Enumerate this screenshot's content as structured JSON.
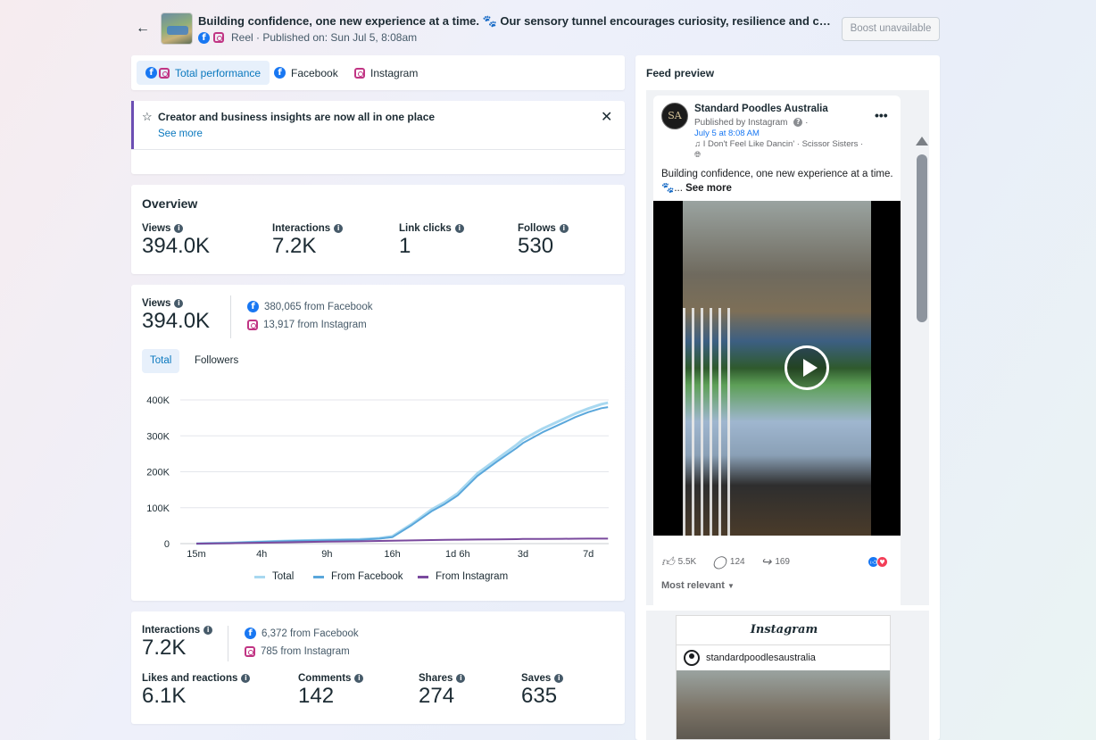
{
  "header": {
    "title": "Building confidence, one new experience at a time. 🐾 Our sensory tunnel encourages curiosity, resilience and confidence. Every step, every sound, every texture, it's all part of raising calm and confident puppies.",
    "meta": "Reel · Published on: Sun Jul 5, 8:08am",
    "boost_label": "Boost unavailable"
  },
  "tabs": [
    {
      "label": "Total performance"
    },
    {
      "label": "Facebook"
    },
    {
      "label": "Instagram"
    }
  ],
  "notice": {
    "title": "Creator and business insights are now all in one place",
    "link": "See more"
  },
  "overview": {
    "title": "Overview",
    "metrics": [
      {
        "label": "Views",
        "value": "394.0K"
      },
      {
        "label": "Interactions",
        "value": "7.2K"
      },
      {
        "label": "Link clicks",
        "value": "1"
      },
      {
        "label": "Follows",
        "value": "530"
      }
    ]
  },
  "views": {
    "label": "Views",
    "value": "394.0K",
    "facebook": "380,065 from Facebook",
    "instagram": "13,917 from Instagram",
    "toggle": [
      "Total",
      "Followers"
    ]
  },
  "chart_data": {
    "type": "line",
    "x_ticks": [
      "15m",
      "4h",
      "9h",
      "16h",
      "1d 6h",
      "3d",
      "7d"
    ],
    "y_ticks": [
      "0",
      "100K",
      "200K",
      "300K",
      "400K"
    ],
    "ylim": [
      0,
      400000
    ],
    "grid": true,
    "legend_position": "bottom",
    "x_index": [
      0,
      0.5,
      1,
      1.5,
      2,
      2.5,
      2.8,
      3,
      3.3,
      3.6,
      3.8,
      4,
      4.3,
      4.6,
      4.9,
      5,
      5.3,
      5.6,
      5.8,
      6,
      6.2,
      6.3
    ],
    "series": [
      {
        "name": "Total",
        "color": "#a8d8f0",
        "values": [
          0,
          2000,
          5000,
          8000,
          10000,
          12000,
          15000,
          20000,
          55000,
          95000,
          115000,
          140000,
          195000,
          235000,
          275000,
          290000,
          320000,
          345000,
          362000,
          376000,
          388000,
          392000
        ]
      },
      {
        "name": "From Facebook",
        "color": "#5aa7db",
        "values": [
          0,
          2000,
          5000,
          7500,
          9500,
          11000,
          14000,
          18000,
          52000,
          90000,
          110000,
          134000,
          188000,
          228000,
          266000,
          280000,
          310000,
          335000,
          352000,
          366000,
          377000,
          380000
        ]
      },
      {
        "name": "From Instagram",
        "color": "#7a4a9e",
        "values": [
          0,
          1000,
          2500,
          4000,
          5500,
          6500,
          7500,
          8000,
          9000,
          10000,
          10500,
          11000,
          11500,
          12000,
          12500,
          13000,
          13200,
          13400,
          13600,
          13800,
          13900,
          13917
        ]
      }
    ]
  },
  "interactions": {
    "label": "Interactions",
    "value": "7.2K",
    "facebook": "6,372 from Facebook",
    "instagram": "785 from Instagram",
    "metrics": [
      {
        "label": "Likes and reactions",
        "value": "6.1K"
      },
      {
        "label": "Comments",
        "value": "142"
      },
      {
        "label": "Shares",
        "value": "274"
      },
      {
        "label": "Saves",
        "value": "635"
      }
    ]
  },
  "feed": {
    "title": "Feed preview",
    "page_name": "Standard Poodles Australia",
    "avatar_text": "SA",
    "published_by": "Published by Instagram",
    "date": "July 5 at 8:08 AM",
    "music": "♫ I Don't Feel Like Dancin' · Scissor Sisters ·",
    "caption": "Building confidence, one new experience at a time. 🐾...",
    "see_more": "See more",
    "likes": "5.5K",
    "comments": "124",
    "shares": "169",
    "most_relevant": "Most relevant",
    "ig_brand": "Instagram",
    "ig_user": "standardpoodlesaustralia"
  }
}
